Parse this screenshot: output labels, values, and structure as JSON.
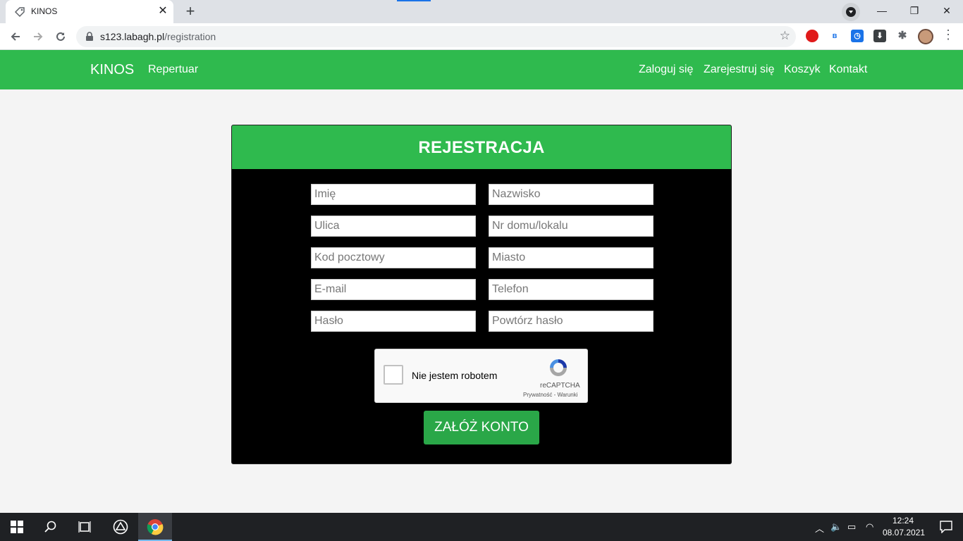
{
  "browser": {
    "tab_title": "KINOS",
    "tab_close": "✕",
    "new_tab": "+",
    "url_host": "s123.labagh.pl",
    "url_path": "/registration",
    "window": {
      "minimize": "—",
      "maximize": "❐",
      "close": "✕"
    }
  },
  "site_nav": {
    "brand": "KINOS",
    "left_links": [
      "Repertuar"
    ],
    "right_links": [
      "Zaloguj się",
      "Zarejestruj się",
      "Koszyk",
      "Kontakt"
    ]
  },
  "form": {
    "title": "REJESTRACJA",
    "fields": [
      {
        "placeholder": "Imię",
        "value": ""
      },
      {
        "placeholder": "Nazwisko",
        "value": ""
      },
      {
        "placeholder": "Ulica",
        "value": ""
      },
      {
        "placeholder": "Nr domu/lokalu",
        "value": ""
      },
      {
        "placeholder": "Kod pocztowy",
        "value": ""
      },
      {
        "placeholder": "Miasto",
        "value": ""
      },
      {
        "placeholder": "E-mail",
        "value": ""
      },
      {
        "placeholder": "Telefon",
        "value": ""
      },
      {
        "placeholder": "Hasło",
        "value": ""
      },
      {
        "placeholder": "Powtórz hasło",
        "value": ""
      }
    ],
    "captcha": {
      "label": "Nie jestem robotem",
      "brand": "reCAPTCHA",
      "terms": "Prywatność - Warunki"
    },
    "submit_label": "ZAŁÓŻ KONTO"
  },
  "taskbar": {
    "time": "12:24",
    "date": "08.07.2021"
  },
  "colors": {
    "brand_green": "#2fba4e",
    "button_green": "#2aa748",
    "card_bg": "#000000",
    "page_bg": "#f4f4f4"
  }
}
